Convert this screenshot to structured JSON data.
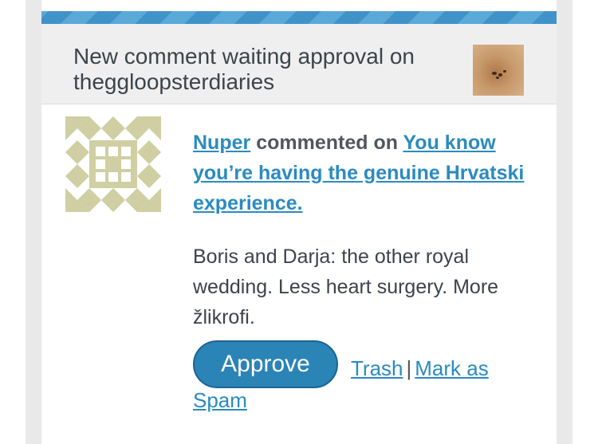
{
  "header": {
    "title": "New comment waiting approval on theggloopsterdiaries",
    "thumbnail_icon": "blog-thumbnail-image"
  },
  "comment": {
    "author": "Nuper",
    "verb": "commented on",
    "post_title": "You know you’re having the genuine Hrvatski experience.",
    "body": "Boris and Darja: the other royal wedding. Less heart surgery. More žlikrofi.",
    "avatar_icon": "identicon-avatar"
  },
  "actions": {
    "approve_label": "Approve",
    "trash_label": "Trash",
    "separator": "|",
    "spam_label": "Mark as Spam"
  },
  "colors": {
    "accent": "#2b84b6",
    "link": "#2a8bbf",
    "header_bg": "#efefef",
    "stripe": "#3f93c7",
    "identicon": "#cfcfa3"
  }
}
